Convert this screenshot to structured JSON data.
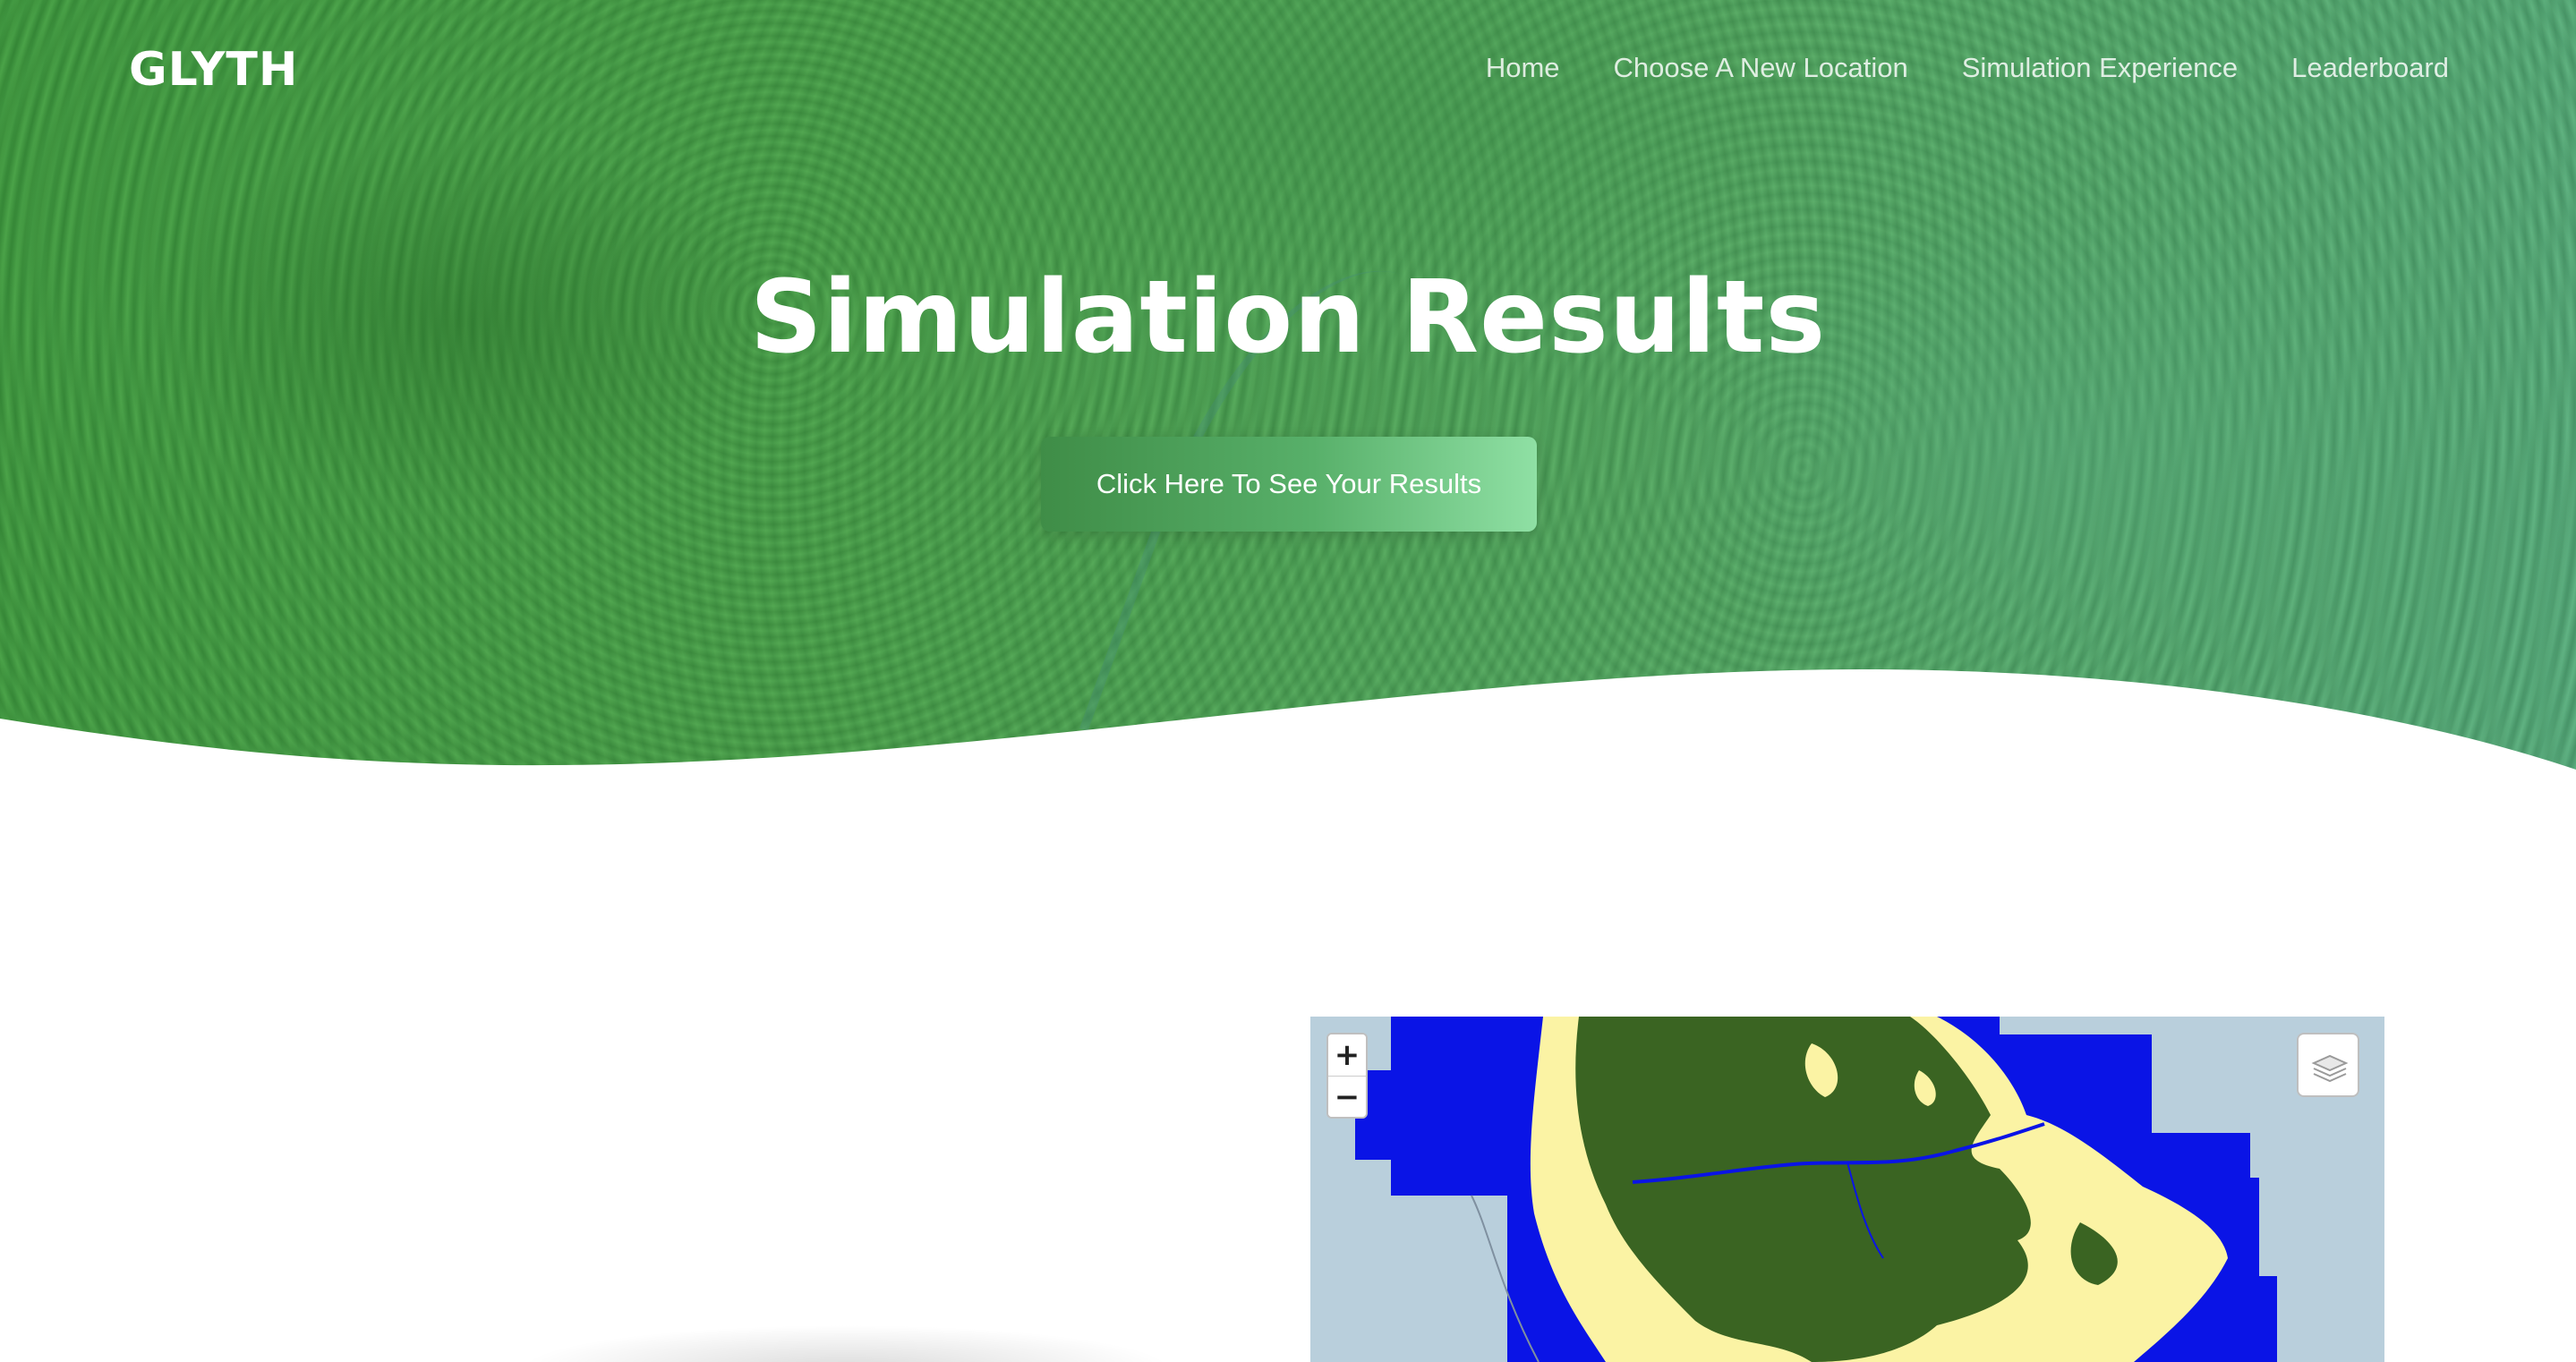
{
  "header": {
    "brand": "GLYTH",
    "nav": [
      {
        "label": "Home"
      },
      {
        "label": "Choose A New Location"
      },
      {
        "label": "Simulation Experience"
      },
      {
        "label": "Leaderboard"
      }
    ]
  },
  "hero": {
    "title": "Simulation Results",
    "cta_label": "Click Here To See Your Results"
  },
  "map": {
    "zoom_in_label": "+",
    "zoom_out_label": "−",
    "legend_colors": {
      "ocean_mask": "#0a14e6",
      "land_background": "#b9cfdc",
      "forest": "#3a6422",
      "non_forest": "#fbf3a4"
    }
  },
  "colors": {
    "hero_green": "#4aa04c",
    "cta_gradient_start": "#3f8d47",
    "cta_gradient_end": "#8fe0a4",
    "text_white": "#ffffff"
  }
}
